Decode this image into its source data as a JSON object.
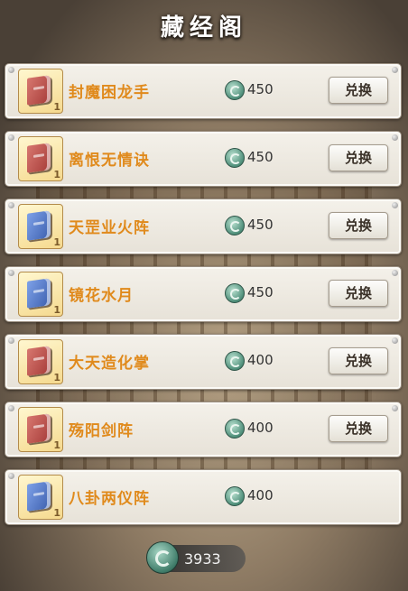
{
  "title": "藏经阁",
  "items": [
    {
      "name": "封魔困龙手",
      "price": "450",
      "button": "兑换",
      "book": "red",
      "count": "1"
    },
    {
      "name": "离恨无情诀",
      "price": "450",
      "button": "兑换",
      "book": "red",
      "count": "1"
    },
    {
      "name": "天罡业火阵",
      "price": "450",
      "button": "兑换",
      "book": "blue",
      "count": "1"
    },
    {
      "name": "镜花水月",
      "price": "450",
      "button": "兑换",
      "book": "blue",
      "count": "1"
    },
    {
      "name": "大天造化掌",
      "price": "400",
      "button": "兑换",
      "book": "red",
      "count": "1"
    },
    {
      "name": "殇阳剑阵",
      "price": "400",
      "button": "兑换",
      "book": "red",
      "count": "1"
    },
    {
      "name": "八卦两仪阵",
      "price": "400",
      "button": "",
      "book": "blue",
      "count": "1"
    }
  ],
  "balance": "3933",
  "colors": {
    "item_name": "#e08a1c",
    "currency": "#4f8f7a"
  }
}
